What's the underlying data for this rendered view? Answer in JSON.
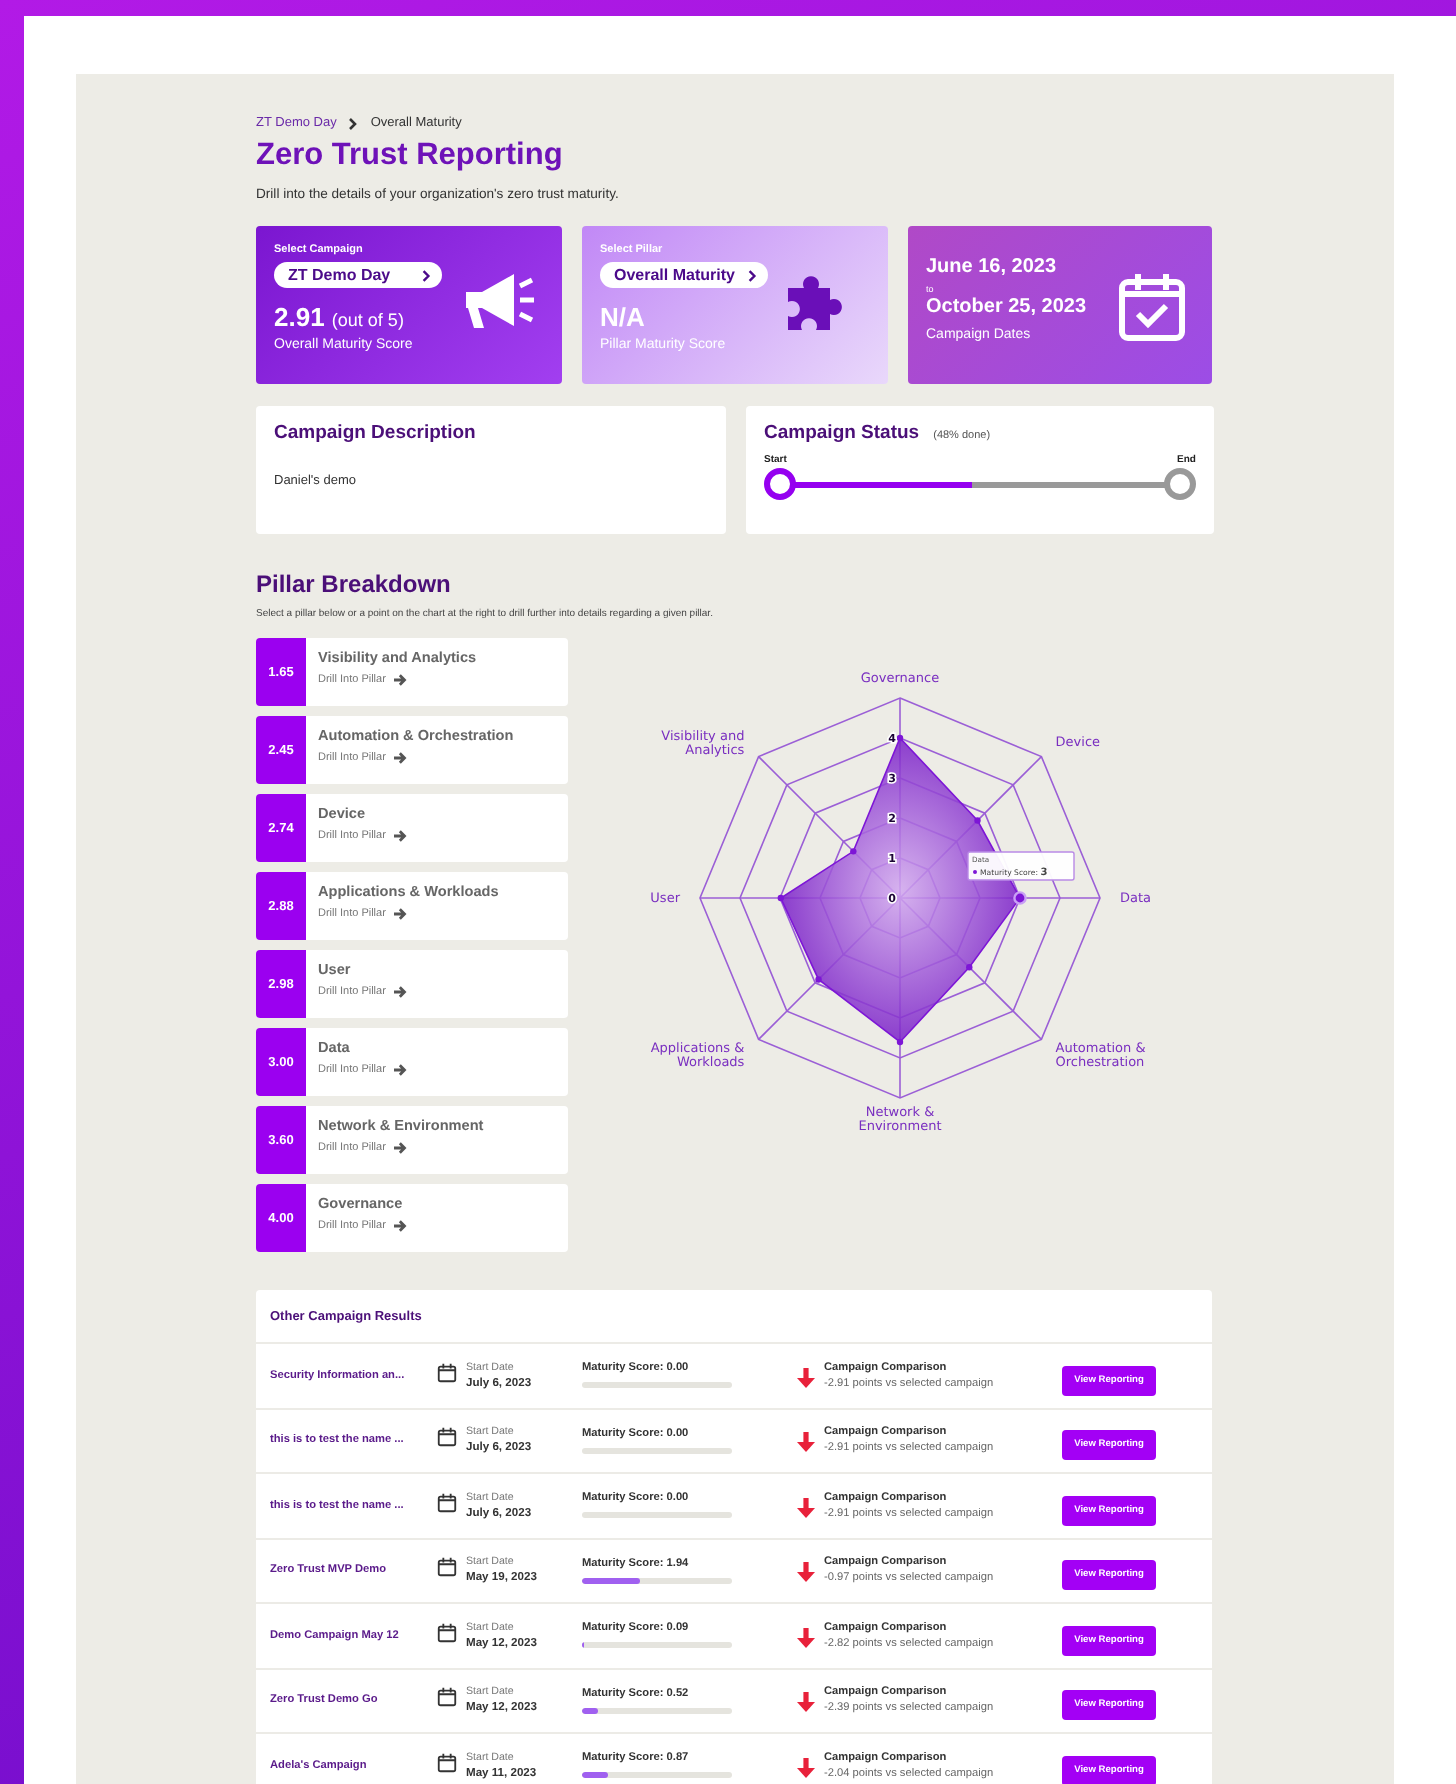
{
  "breadcrumb": [
    {
      "label": "ZT Demo Day",
      "kind": "link"
    },
    {
      "label": "Overall Maturity",
      "kind": "current"
    }
  ],
  "title": "Zero Trust Reporting",
  "subtitle": "Drill into the details of your organization's zero trust maturity.",
  "cards": [
    {
      "kind": "campaign",
      "label": "Select Campaign",
      "select": "ZT Demo Day",
      "score": "2.91",
      "score_note": "(out of 5)",
      "caption": "Overall Maturity Score"
    },
    {
      "kind": "pillar",
      "label": "Select Pillar",
      "select": "Overall Maturity",
      "score": "N/A",
      "caption": "Pillar Maturity Score"
    },
    {
      "kind": "dates",
      "start": "June 16, 2023",
      "to": "to",
      "end": "October 25, 2023",
      "caption": "Campaign Dates"
    }
  ],
  "description": {
    "title": "Campaign Description",
    "text": "Daniel's demo"
  },
  "status": {
    "title": "Campaign Status",
    "note": "(48% done)",
    "start_label": "Start",
    "end_label": "End",
    "level": 0.48
  },
  "pillars": {
    "title": "Pillar Breakdown",
    "hint": "Select a pillar below or a point on the chart at the right to drill further into details regarding a given pillar.",
    "items": [
      {
        "score": "1.65",
        "name": "Visibility and Analytics",
        "action": "Drill Into Pillar"
      },
      {
        "score": "2.45",
        "name": "Automation & Orchestration",
        "action": "Drill Into Pillar"
      },
      {
        "score": "2.74",
        "name": "Device",
        "action": "Drill Into Pillar"
      },
      {
        "score": "2.88",
        "name": "Applications & Workloads",
        "action": "Drill Into Pillar"
      },
      {
        "score": "2.98",
        "name": "User",
        "action": "Drill Into Pillar"
      },
      {
        "score": "3.00",
        "name": "Data",
        "action": "Drill Into Pillar"
      },
      {
        "score": "3.60",
        "name": "Network & Environment",
        "action": "Drill Into Pillar"
      },
      {
        "score": "4.00",
        "name": "Governance",
        "action": "Drill Into Pillar"
      }
    ],
    "radar": {
      "ticks": [
        "4",
        "3",
        "2",
        "1",
        "0"
      ],
      "axes": [
        {
          "label": "Governance",
          "kind": "north"
        },
        {
          "label": "Visibility and Analytics",
          "kind": "northwest"
        },
        {
          "label": "Device",
          "kind": "northeast"
        },
        {
          "label": "User",
          "kind": "west"
        },
        {
          "label": "Data",
          "kind": "east"
        },
        {
          "label": "Applications & Workloads",
          "kind": "southwest"
        },
        {
          "label": "Automation & Orchestration",
          "kind": "southeast"
        },
        {
          "label": "Network & Environment",
          "kind": "south"
        }
      ],
      "tooltip": {
        "title": "Data",
        "label": "Maturity Score:",
        "value": "3"
      }
    }
  },
  "campaigns": {
    "title": "Other Campaign Results",
    "rows": [
      {
        "name": "Security Information an...",
        "date_label": "Start Date",
        "date": "July 6, 2023",
        "score": "Maturity Score: 0.00",
        "comparison_title": "Campaign Comparison",
        "comparison": "-2.91 points vs selected campaign",
        "button": "View Reporting"
      },
      {
        "name": "this is to test the name ...",
        "date_label": "Start Date",
        "date": "July 6, 2023",
        "score": "Maturity Score: 0.00",
        "comparison_title": "Campaign Comparison",
        "comparison": "-2.91 points vs selected campaign",
        "button": "View Reporting"
      },
      {
        "name": "this is to test the name ...",
        "date_label": "Start Date",
        "date": "July 6, 2023",
        "score": "Maturity Score: 0.00",
        "comparison_title": "Campaign Comparison",
        "comparison": "-2.91 points vs selected campaign",
        "button": "View Reporting"
      },
      {
        "name": "Zero Trust MVP Demo",
        "date_label": "Start Date",
        "date": "May 19, 2023",
        "score": "Maturity Score: 1.94",
        "level": 0.388,
        "comparison_title": "Campaign Comparison",
        "comparison": "-0.97 points vs selected campaign",
        "button": "View Reporting"
      },
      {
        "name": "Demo Campaign May 12",
        "date_label": "Start Date",
        "date": "May 12, 2023",
        "score": "Maturity Score: 0.09",
        "level": 0.018,
        "comparison_title": "Campaign Comparison",
        "comparison": "-2.82 points vs selected campaign",
        "button": "View Reporting"
      },
      {
        "name": "Zero Trust Demo Go",
        "date_label": "Start Date",
        "date": "May 12, 2023",
        "score": "Maturity Score: 0.52",
        "level": 0.104,
        "comparison_title": "Campaign Comparison",
        "comparison": "-2.39 points vs selected campaign",
        "button": "View Reporting"
      },
      {
        "name": "Adela's Campaign",
        "date_label": "Start Date",
        "date": "May 11, 2023",
        "score": "Maturity Score: 0.87",
        "level": 0.174,
        "comparison_title": "Campaign Comparison",
        "comparison": "-2.04 points vs selected campaign",
        "button": "View Reporting"
      }
    ]
  }
}
